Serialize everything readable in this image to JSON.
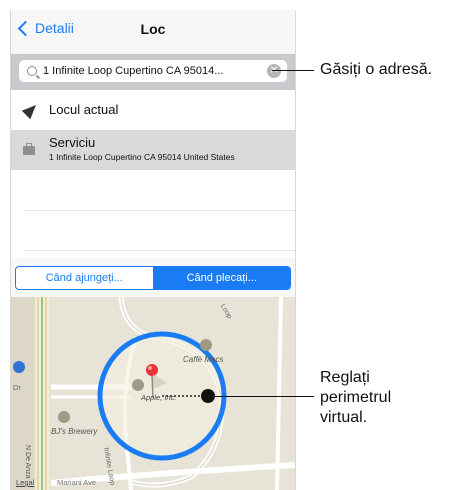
{
  "navbar": {
    "back_label": "Detalii",
    "title": "Loc"
  },
  "search": {
    "value": "1 Infinite Loop Cupertino CA 95014..."
  },
  "current_location": {
    "label": "Locul actual"
  },
  "work": {
    "title": "Serviciu",
    "address": "1 Infinite Loop Cupertino CA 95014 United States"
  },
  "segment": {
    "arrive": "Când ajungeți...",
    "leave": "Când plecați...",
    "selected": "leave"
  },
  "map": {
    "labels": {
      "caffe_macs": "Caffè Macs",
      "apple_inc": "Apple, Inc.",
      "bjs_brewery": "BJ's Brewery",
      "infinite_loop": "Infinite Loop",
      "mariani_ave": "Mariani Ave",
      "n_de_anza": "N De Anza",
      "legal": "Legal",
      "loop": "Loop",
      "dr": "Dr"
    }
  },
  "callouts": {
    "find_address": "Găsiți o adresă.",
    "adjust_line1": "Reglați",
    "adjust_line2": "perimetrul",
    "adjust_line3": "virtual."
  },
  "colors": {
    "accent": "#1a7cf5",
    "pin": "#e8333a",
    "map_bg": "#e7e3d6"
  }
}
